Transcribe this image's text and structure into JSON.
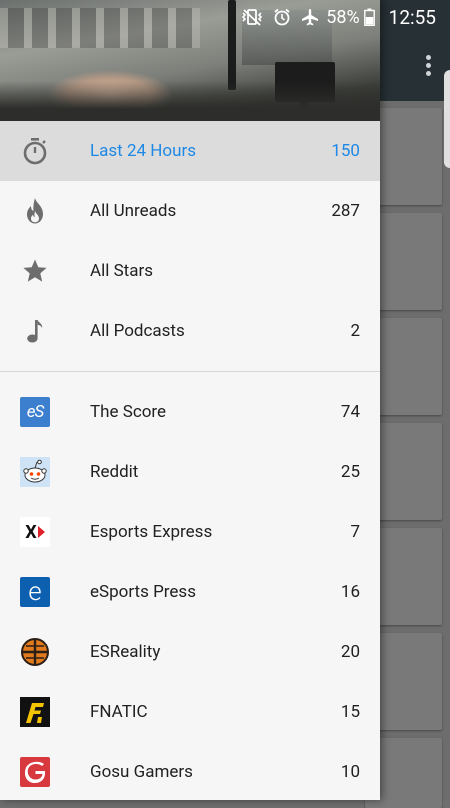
{
  "status_bar": {
    "battery": "58%",
    "time": "12:55",
    "icons": [
      "vibrate-mute-icon",
      "alarm-icon",
      "airplane-mode-icon",
      "battery-icon"
    ]
  },
  "drawer": {
    "smart_feeds": [
      {
        "label": "Last 24 Hours",
        "count": "150",
        "icon": "stopwatch-icon",
        "active": true
      },
      {
        "label": "All Unreads",
        "count": "287",
        "icon": "flame-icon"
      },
      {
        "label": "All Stars",
        "count": "",
        "icon": "star-icon"
      },
      {
        "label": "All Podcasts",
        "count": "2",
        "icon": "music-note-icon"
      }
    ],
    "feeds": [
      {
        "label": "The Score",
        "count": "74",
        "icon": "the-score-favicon"
      },
      {
        "label": "Reddit",
        "count": "25",
        "icon": "reddit-favicon"
      },
      {
        "label": "Esports Express",
        "count": "7",
        "icon": "esports-express-favicon"
      },
      {
        "label": "eSports Press",
        "count": "16",
        "icon": "esports-press-favicon"
      },
      {
        "label": "ESReality",
        "count": "20",
        "icon": "esreality-favicon"
      },
      {
        "label": "FNATIC",
        "count": "15",
        "icon": "fnatic-favicon"
      },
      {
        "label": "Gosu Gamers",
        "count": "10",
        "icon": "gosu-gamers-favicon"
      }
    ]
  },
  "colors": {
    "accent": "#1e88e5",
    "toolbar": "#263035",
    "drawer_bg": "#f6f6f6",
    "active_row": "#dcdcdc"
  }
}
